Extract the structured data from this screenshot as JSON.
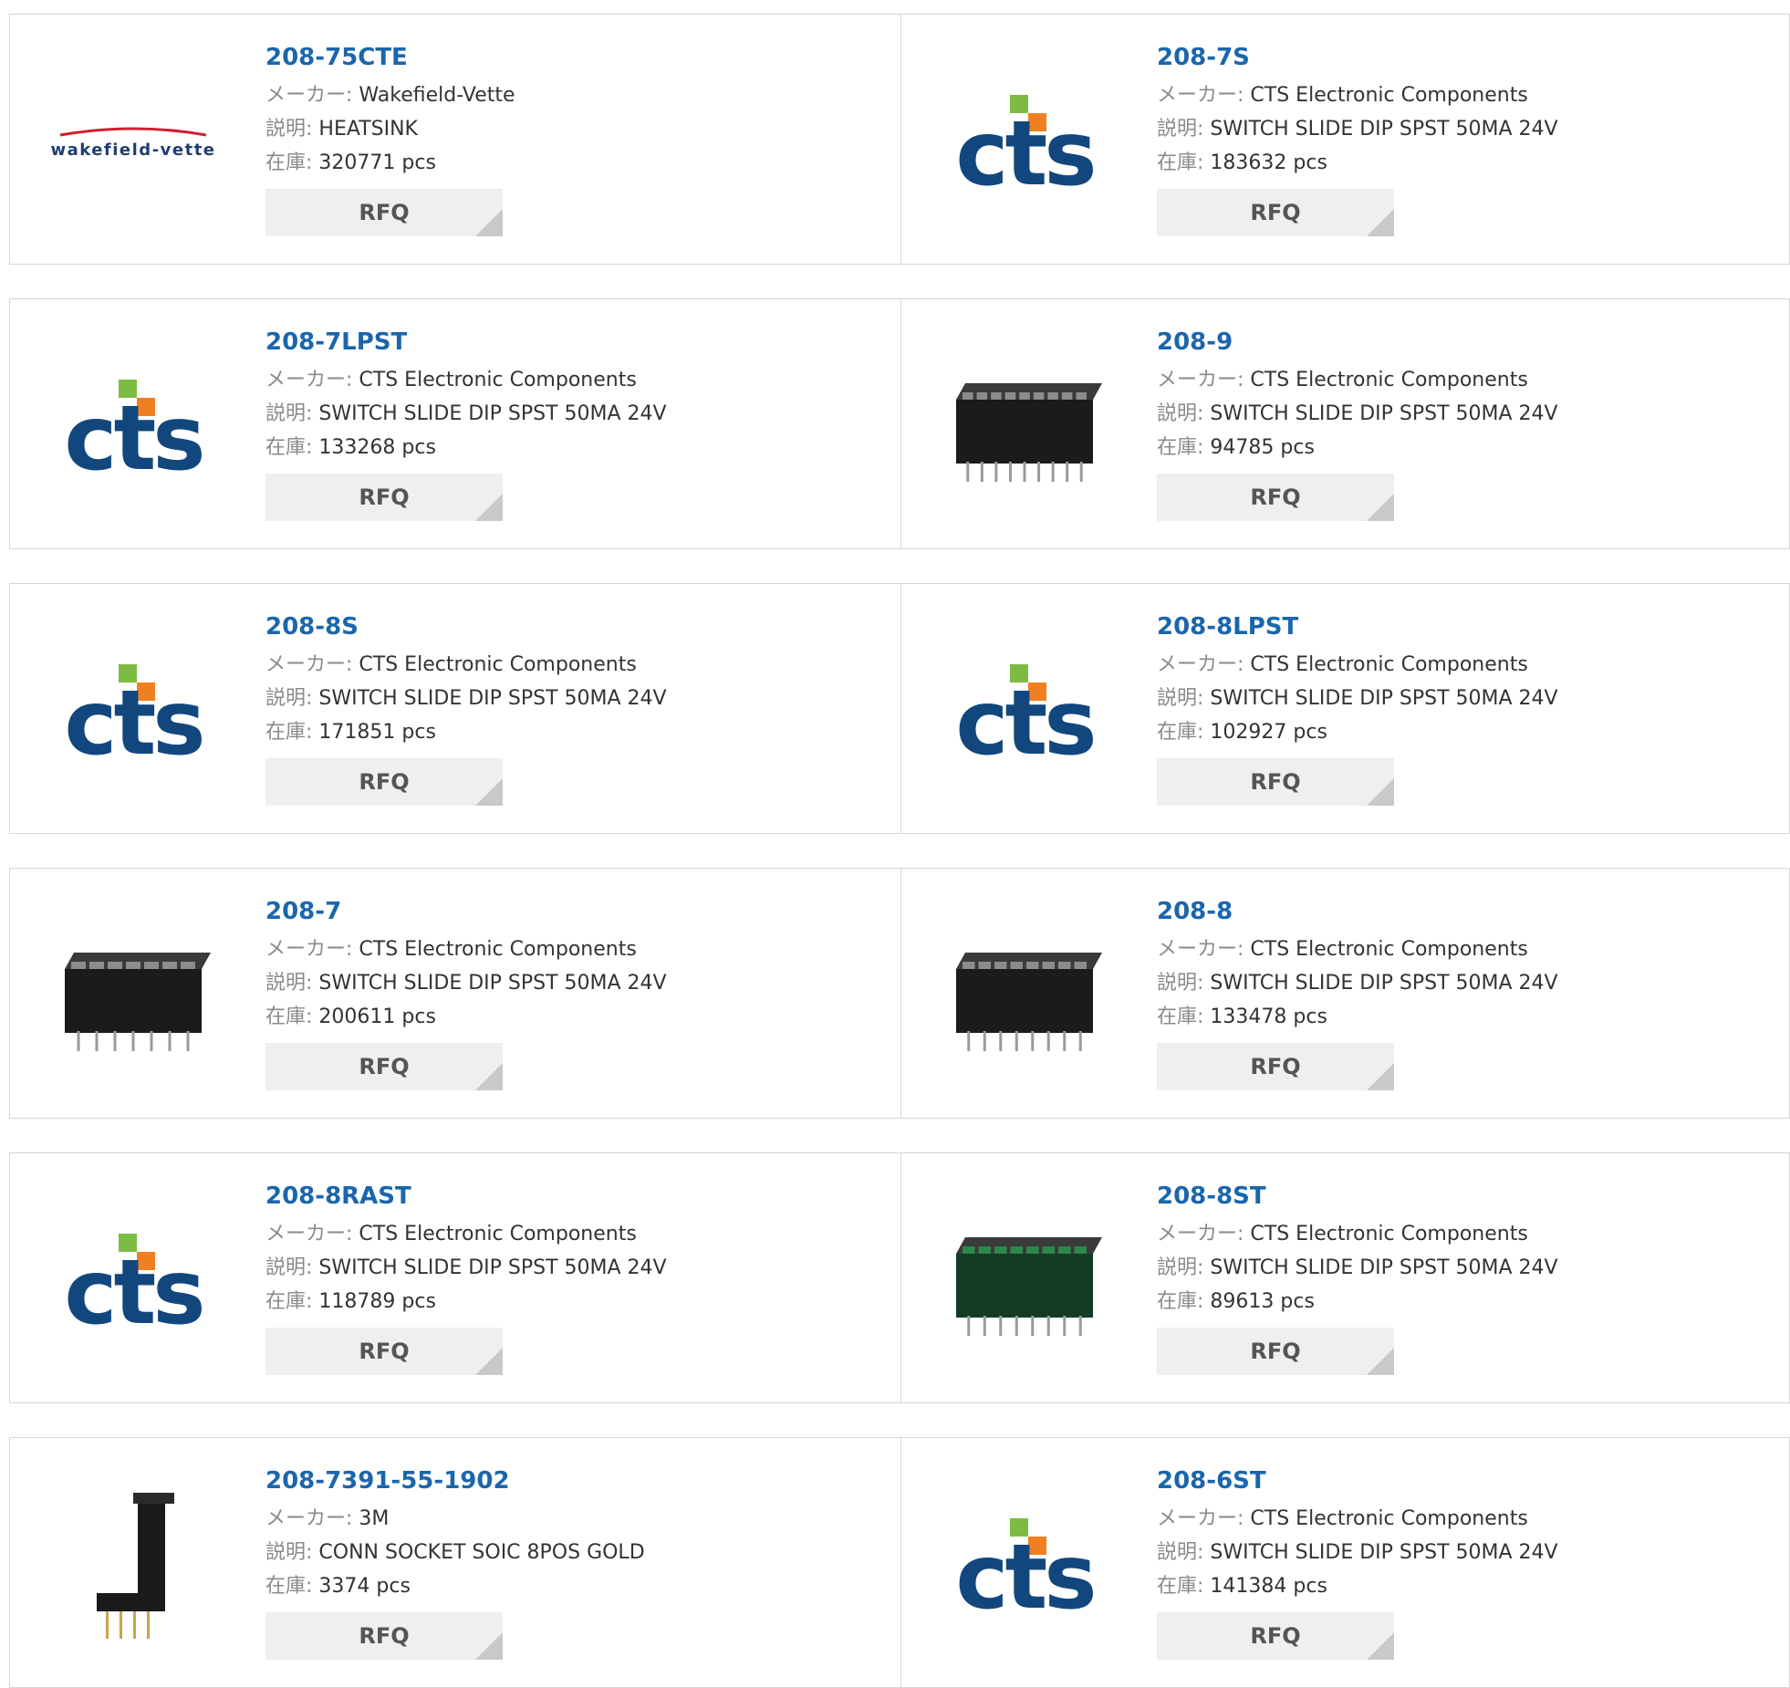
{
  "labels": {
    "maker": "メーカー:",
    "desc": "説明:",
    "stock": "在庫:",
    "rfq": "RFQ"
  },
  "products": [
    {
      "part": "208-75CTE",
      "maker": "Wakefield-Vette",
      "desc": "HEATSINK",
      "stock": "320771 pcs",
      "image": "wakefield-vette-logo",
      "logo_text": "wakefield-vette"
    },
    {
      "part": "208-7S",
      "maker": "CTS Electronic Components",
      "desc": "SWITCH SLIDE DIP SPST 50MA 24V",
      "stock": "183632 pcs",
      "image": "cts-logo",
      "logo_text": "cts"
    },
    {
      "part": "208-7LPST",
      "maker": "CTS Electronic Components",
      "desc": "SWITCH SLIDE DIP SPST 50MA 24V",
      "stock": "133268 pcs",
      "image": "cts-logo",
      "logo_text": "cts"
    },
    {
      "part": "208-9",
      "maker": "CTS Electronic Components",
      "desc": "SWITCH SLIDE DIP SPST 50MA 24V",
      "stock": "94785 pcs",
      "image": "dip-switch-9",
      "logo_text": ""
    },
    {
      "part": "208-8S",
      "maker": "CTS Electronic Components",
      "desc": "SWITCH SLIDE DIP SPST 50MA 24V",
      "stock": "171851 pcs",
      "image": "cts-logo",
      "logo_text": "cts"
    },
    {
      "part": "208-8LPST",
      "maker": "CTS Electronic Components",
      "desc": "SWITCH SLIDE DIP SPST 50MA 24V",
      "stock": "102927 pcs",
      "image": "cts-logo",
      "logo_text": "cts"
    },
    {
      "part": "208-7",
      "maker": "CTS Electronic Components",
      "desc": "SWITCH SLIDE DIP SPST 50MA 24V",
      "stock": "200611 pcs",
      "image": "dip-switch-7",
      "logo_text": ""
    },
    {
      "part": "208-8",
      "maker": "CTS Electronic Components",
      "desc": "SWITCH SLIDE DIP SPST 50MA 24V",
      "stock": "133478 pcs",
      "image": "dip-switch-8",
      "logo_text": ""
    },
    {
      "part": "208-8RAST",
      "maker": "CTS Electronic Components",
      "desc": "SWITCH SLIDE DIP SPST 50MA 24V",
      "stock": "118789 pcs",
      "image": "cts-logo",
      "logo_text": "cts"
    },
    {
      "part": "208-8ST",
      "maker": "CTS Electronic Components",
      "desc": "SWITCH SLIDE DIP SPST 50MA 24V",
      "stock": "89613 pcs",
      "image": "dip-switch-green",
      "logo_text": ""
    },
    {
      "part": "208-7391-55-1902",
      "maker": "3M",
      "desc": "CONN SOCKET SOIC 8POS GOLD",
      "stock": "3374 pcs",
      "image": "socket-photo",
      "logo_text": ""
    },
    {
      "part": "208-6ST",
      "maker": "CTS Electronic Components",
      "desc": "SWITCH SLIDE DIP SPST 50MA 24V",
      "stock": "141384 pcs",
      "image": "cts-logo",
      "logo_text": "cts"
    }
  ],
  "colors": {
    "link": "#1a66ad",
    "cts_blue": "#12477d",
    "cts_green": "#7cbc42",
    "cts_orange": "#f07f21",
    "wakefield_red": "#d0202f",
    "wakefield_text": "#1f3d73"
  }
}
